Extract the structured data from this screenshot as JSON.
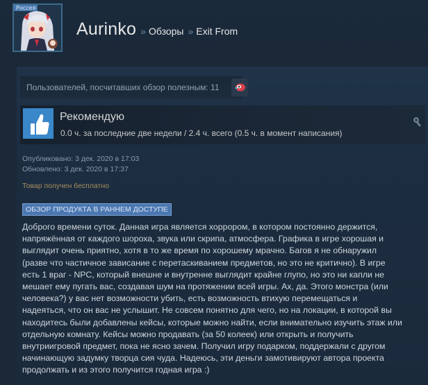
{
  "header": {
    "avatar_badge": "Россея",
    "user_name": "Aurinko",
    "separator": "»",
    "crumb_reviews": "Обзоры",
    "crumb_game": "Exit From"
  },
  "review": {
    "helpful_text": "Пользователей, посчитавших обзор полезным: 11",
    "recommendation": "Рекомендую",
    "hours": "0.0 ч. за последние две недели / 2.4 ч. всего (0.5 ч. в момент написания)",
    "posted": "Опубликовано: 3 дек. 2020 в 17:03",
    "updated": "Обновлено: 3 дек. 2020 в 17:37",
    "free_note": "Товар получен бесплатно",
    "early_access_banner": "ОБЗОР ПРОДУКТА В РАННЕМ ДОСТУПЕ",
    "lines": [
      "Доброго времени суток. Данная игра является хоррором, в котором постоянно держится,",
      "напряжённая от каждого шороха, звука или скрипа, атмосфера. Графика в игре хорошая и",
      "выглядит очень приятно, хотя в то же время по хорошему мрачно. Багов я не обнаружил",
      "(разве что частичное зависание с перетаскиванием предметов, но это не критично). В игре",
      "есть 1 враг - NPC, который внешне и внутренне выглядит крайне глупо, но это ни капли не",
      "мешает ему пугать вас, создавая шум на протяжении всей игры. Ах, да. Этого монстра (или",
      "человека?) у вас нет возможности убить, есть возможность втихую перемещаться и",
      "надеяться, что он вас не услышит. Не совсем понятно для чего, но на локации, в которой вы",
      "находитесь были добавлены кейсы, которые можно найти, если внимательно изучить этаж или",
      "отдельную комнату. Кейсы можно продавать (за 50 колеек) или открыть и получить",
      "внутриигровой предмет, пока не ясно зачем. Получил игру подарком, поддержали с другом",
      "начинающую задумку творца сия чуда. Надеюсь, эти деньги замотивируют автора проекта",
      "продолжать и из этого получится годная игра :)"
    ]
  },
  "icons": {
    "thumb": "thumbs-up-icon",
    "award": "award-icon",
    "developer": "developer-response-icon"
  },
  "colors": {
    "background": "#1b2838",
    "thumb_bg": "#3a87c9",
    "banner_bg": "#4b77b0",
    "free_note": "#a88f5f"
  }
}
